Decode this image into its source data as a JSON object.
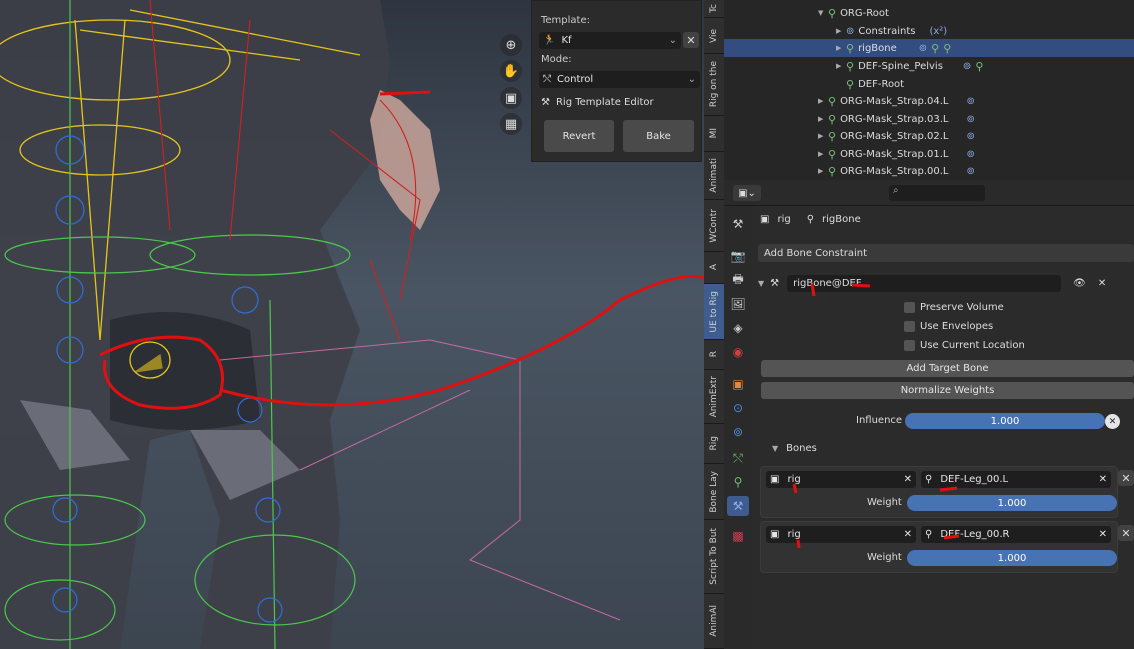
{
  "popup": {
    "template_label": "Template:",
    "template_value": "Kf",
    "mode_label": "Mode:",
    "mode_value": "Control",
    "editor_label": "Rig Template Editor",
    "revert": "Revert",
    "bake": "Bake"
  },
  "vtabs": [
    "Tc",
    "Vie",
    "Rig on the",
    "MI",
    "Animati",
    "WContr",
    "A",
    "UE to Rig",
    "R",
    "AnimExtr",
    "Rig",
    "Bone Lay",
    "Script To But",
    "AnimAl"
  ],
  "outliner": [
    {
      "label": "ORG-Root",
      "indent": 0
    },
    {
      "label": "Constraints",
      "indent": 1
    },
    {
      "label": "rigBone",
      "indent": 1,
      "selected": true
    },
    {
      "label": "DEF-Spine_Pelvis",
      "indent": 1
    },
    {
      "label": "DEF-Root",
      "indent": 1
    },
    {
      "label": "ORG-Mask_Strap.04.L",
      "indent": 0
    },
    {
      "label": "ORG-Mask_Strap.03.L",
      "indent": 0
    },
    {
      "label": "ORG-Mask_Strap.02.L",
      "indent": 0
    },
    {
      "label": "ORG-Mask_Strap.01.L",
      "indent": 0
    },
    {
      "label": "ORG-Mask_Strap.00.L",
      "indent": 0
    }
  ],
  "props": {
    "breadcrumb_obj": "rig",
    "breadcrumb_bone": "rigBone",
    "add_constraint": "Add Bone Constraint",
    "constraint_name": "rigBone@DEF",
    "preserve_volume": "Preserve Volume",
    "use_envelopes": "Use Envelopes",
    "use_current_location": "Use Current Location",
    "add_target_bone": "Add Target Bone",
    "normalize_weights": "Normalize Weights",
    "influence_label": "Influence",
    "influence_value": "1.000",
    "bones_label": "Bones",
    "targets": [
      {
        "obj": "rig",
        "bone": "DEF-Leg_00.L",
        "weight_label": "Weight",
        "weight": "1.000"
      },
      {
        "obj": "rig",
        "bone": "DEF-Leg_00.R",
        "weight_label": "Weight",
        "weight": "1.000"
      }
    ]
  }
}
